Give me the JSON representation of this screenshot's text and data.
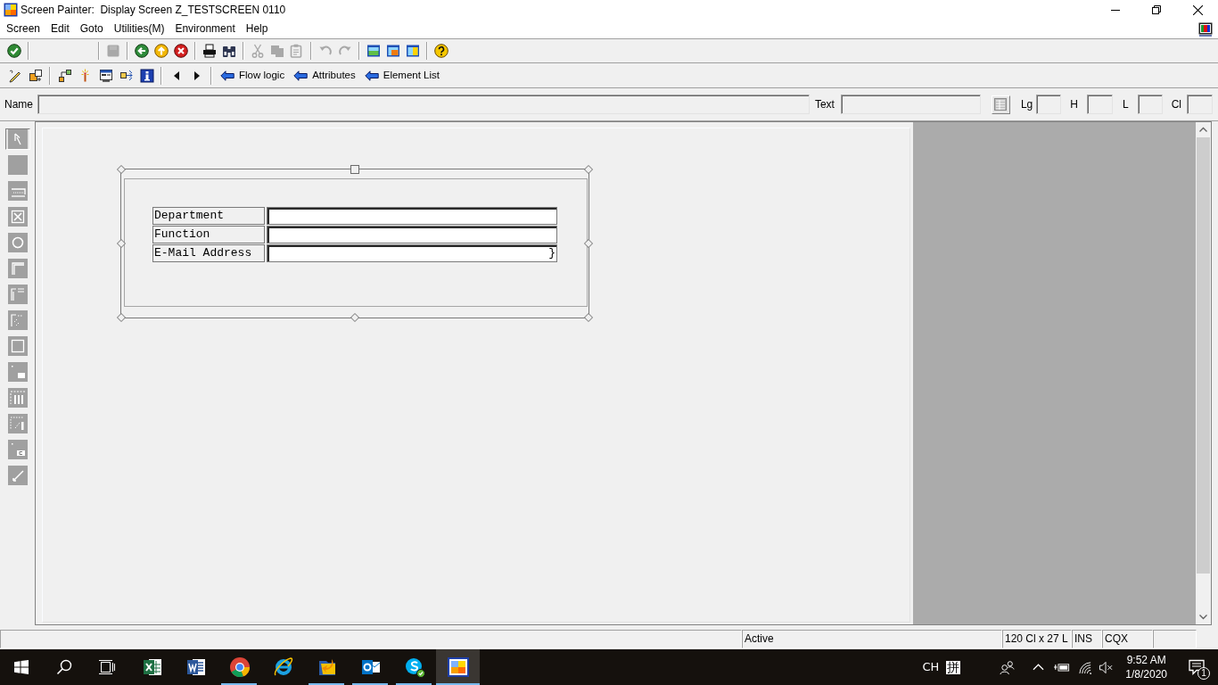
{
  "window": {
    "title": "Screen Painter:  Display Screen Z_TESTSCREEN 0110"
  },
  "menu_bar": {
    "items": [
      {
        "label": "Screen"
      },
      {
        "label": "Edit"
      },
      {
        "label": "Goto"
      },
      {
        "label": "Utilities(M)"
      },
      {
        "label": "Environment"
      },
      {
        "label": "Help"
      }
    ]
  },
  "standard_toolbar": {
    "groups": [
      [
        {
          "disabled": false
        }
      ],
      [
        {
          "disabled": true
        }
      ],
      [
        {
          "disabled": false
        },
        {
          "disabled": false
        },
        {
          "disabled": false
        }
      ],
      [
        {
          "disabled": false
        },
        {
          "disabled": false
        }
      ],
      [
        {
          "disabled": true
        },
        {
          "disabled": true
        },
        {
          "disabled": true
        }
      ],
      [
        {
          "disabled": true
        },
        {
          "disabled": true
        }
      ],
      [
        {
          "disabled": false
        },
        {
          "disabled": false
        },
        {
          "disabled": false
        }
      ],
      [
        {
          "disabled": false
        }
      ]
    ]
  },
  "application_toolbar": {
    "buttons": [
      {
        "label": "Flow logic"
      },
      {
        "label": "Attributes"
      },
      {
        "label": "Element List"
      }
    ]
  },
  "attributes_bar": {
    "fields": [
      {
        "label": "Name"
      },
      {
        "label": "Text"
      },
      {
        "label": "Lg"
      },
      {
        "label": "H"
      },
      {
        "label": "L"
      },
      {
        "label": "Cl"
      }
    ]
  },
  "element_palette": [
    {
      "selected": true
    },
    {
      "selected": false
    },
    {
      "selected": false
    },
    {
      "selected": false
    },
    {
      "selected": false
    },
    {
      "selected": false
    },
    {
      "selected": false
    },
    {
      "selected": false
    },
    {
      "selected": false
    },
    {
      "selected": false
    },
    {
      "selected": false
    },
    {
      "selected": false
    },
    {
      "selected": false
    },
    {
      "selected": false
    }
  ],
  "screen_layout": {
    "rows": [
      {
        "label": "Department"
      },
      {
        "label": "Function"
      },
      {
        "label": "E-Mail Address",
        "end_mark": "}"
      }
    ]
  },
  "status_bar": {
    "fields": [
      "Active",
      "120 Cl x 27 L",
      "INS",
      "CQX"
    ]
  },
  "taskbar": {
    "apps": [
      {
        "running": false,
        "selected": false
      },
      {
        "running": false,
        "selected": false
      },
      {
        "running": true,
        "selected": false
      },
      {
        "running": false,
        "selected": false
      },
      {
        "running": true,
        "selected": false
      },
      {
        "running": true,
        "selected": false
      },
      {
        "running": true,
        "selected": false
      },
      {
        "running": true,
        "selected": true
      }
    ],
    "language": "CH",
    "input_method": "拼",
    "time": "9:52 AM",
    "date": "1/8/2020",
    "notification_count": "1"
  }
}
